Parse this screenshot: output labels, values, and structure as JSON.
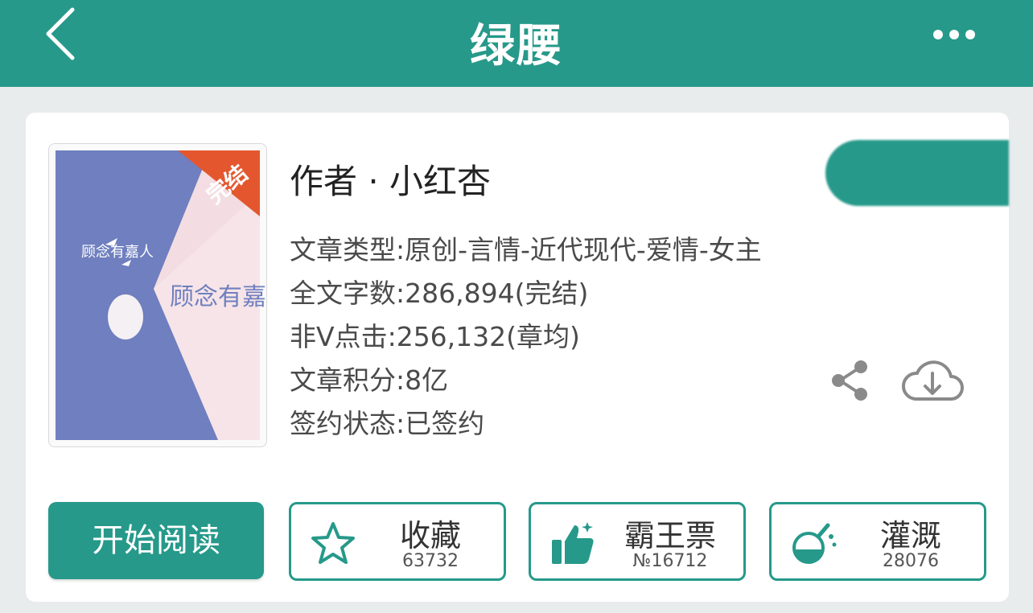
{
  "header": {
    "title": "绿腰",
    "back_icon": "chevron-left-icon",
    "more_icon": "more-horizontal-icon",
    "bg_color": "#26998a"
  },
  "book": {
    "cover_title": "顾念有嘉人",
    "cover_badge": "完结",
    "author": "作者 · 小红杏",
    "details": [
      "文章类型:原创-言情-近代现代-爱情-女主",
      "全文字数:286,894(完结)",
      "非V点击:256,132(章均)",
      "文章积分:8亿",
      "签约状态:已签约"
    ]
  },
  "side_actions": {
    "share_icon": "share-icon",
    "download_icon": "cloud-download-icon"
  },
  "actions": {
    "read_label": "开始阅读",
    "favorite": {
      "label": "收藏",
      "count": "63732",
      "icon": "star-icon"
    },
    "vote": {
      "label": "霸王票",
      "count": "№16712",
      "icon": "thumbs-up-icon"
    },
    "water": {
      "label": "灌溉",
      "count": "28076",
      "icon": "flask-icon"
    }
  },
  "accent_color": "#26998a"
}
